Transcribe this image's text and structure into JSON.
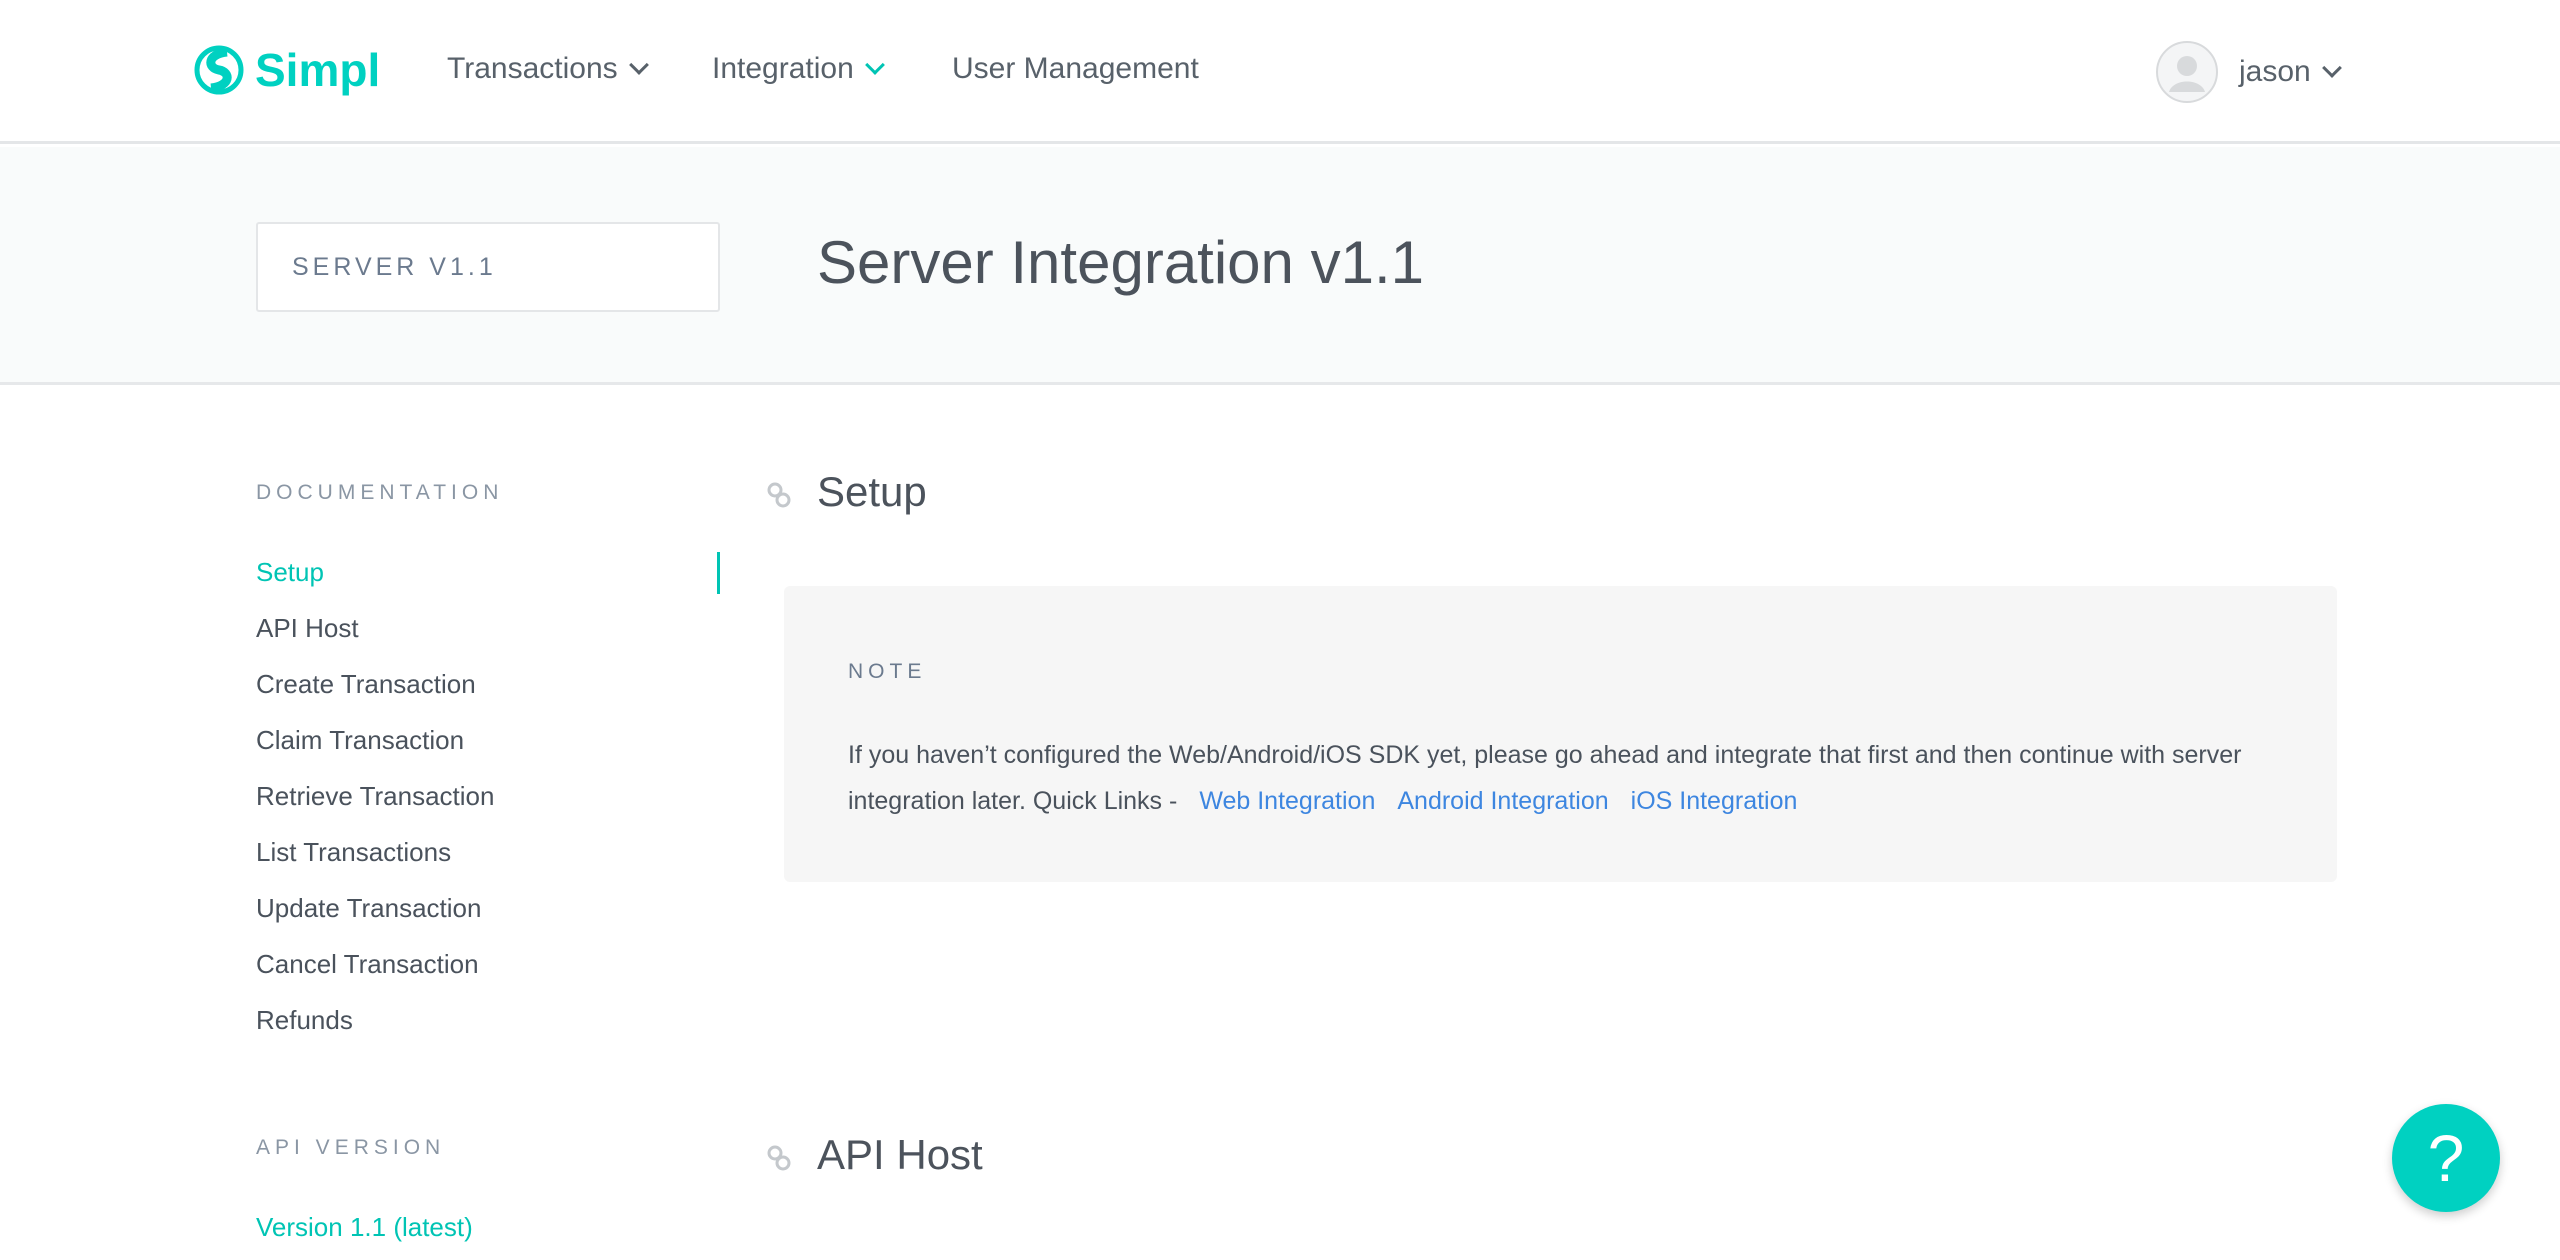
{
  "header": {
    "brand": "Simpl",
    "nav": [
      {
        "label": "Transactions",
        "has_dropdown": true
      },
      {
        "label": "Integration",
        "has_dropdown": true
      },
      {
        "label": "User Management",
        "has_dropdown": false
      }
    ],
    "user": "jason"
  },
  "band": {
    "version_selector": "SERVER V1.1",
    "title": "Server Integration v1.1"
  },
  "sidebar": {
    "documentation_label": "DOCUMENTATION",
    "items": [
      "Setup",
      "API Host",
      "Create Transaction",
      "Claim Transaction",
      "Retrieve Transaction",
      "List Transactions",
      "Update Transaction",
      "Cancel Transaction",
      "Refunds"
    ],
    "active": "Setup",
    "api_version_label": "API VERSION",
    "version": "Version 1.1 (latest)"
  },
  "main": {
    "setup_heading": "Setup",
    "note": {
      "label": "NOTE",
      "text": "If you haven’t configured the Web/Android/iOS SDK yet, please go ahead and integrate that first and then continue with server integration later. Quick Links  -",
      "links": [
        "Web Integration",
        "Android Integration",
        "iOS Integration"
      ]
    },
    "api_host_heading": "API Host"
  },
  "help_button": "?",
  "colors": {
    "accent": "#00c4b4",
    "link": "#3d86e0"
  }
}
